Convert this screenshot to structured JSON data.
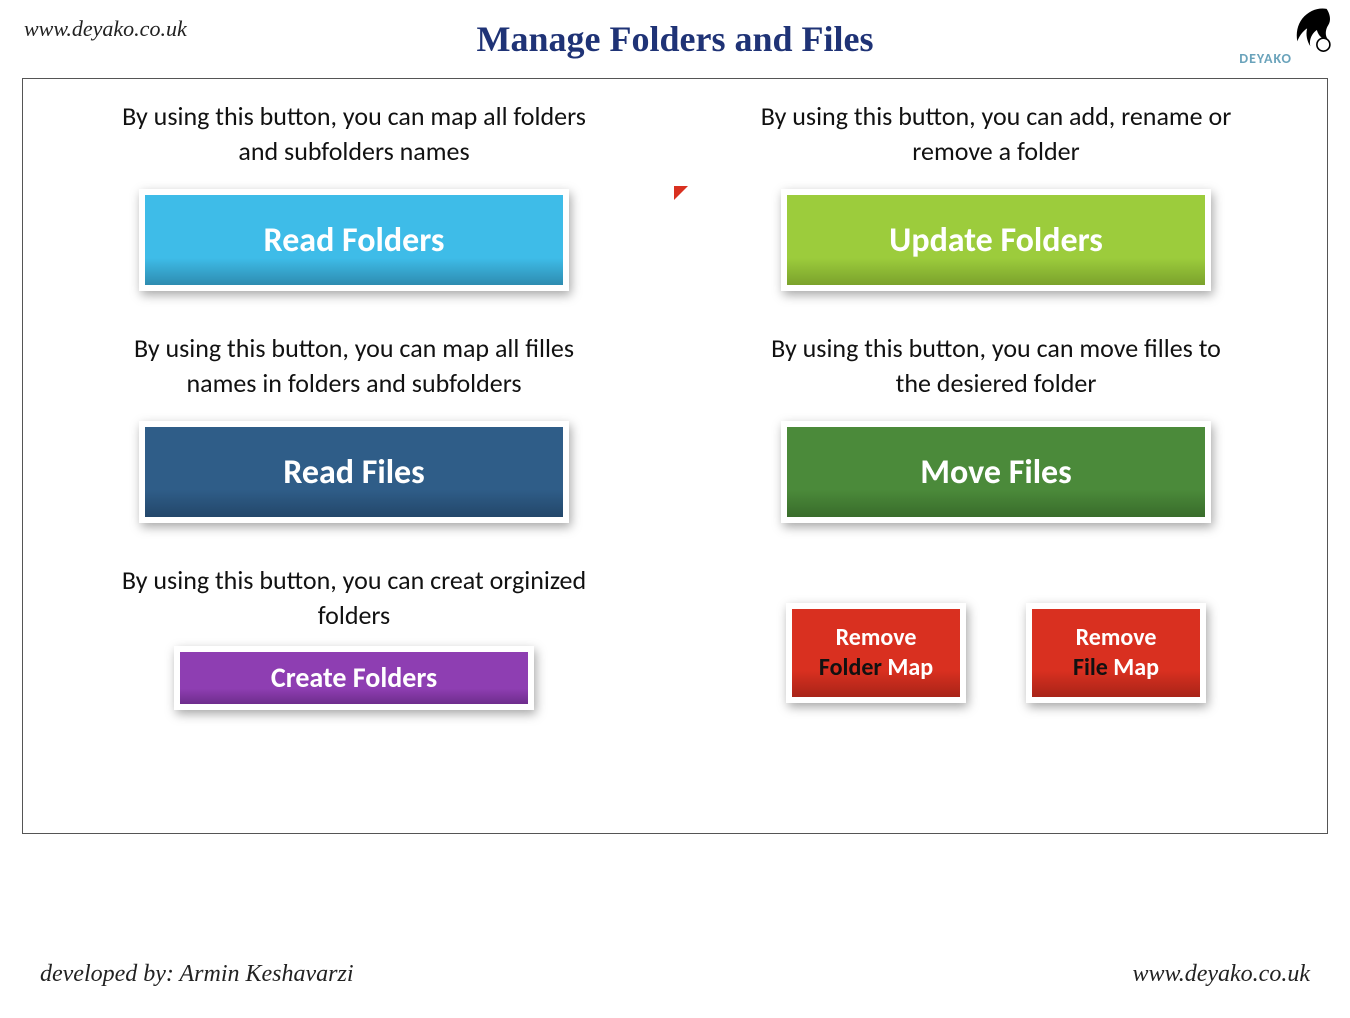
{
  "header": {
    "url": "www.deyako.co.uk",
    "title": "Manage Folders and Files",
    "logo_text": "DEYAKO"
  },
  "left": {
    "block1": {
      "blurb": "By using this button, you can map all folders and subfolders names",
      "button": "Read Folders"
    },
    "block2": {
      "blurb": "By using this button, you can map all filles names in folders and subfolders",
      "button": "Read Files"
    },
    "block3": {
      "blurb": "By using this button, you can creat orginized folders",
      "button": "Create Folders"
    }
  },
  "right": {
    "block1": {
      "blurb": "By using this button, you can add, rename or remove a folder",
      "button": "Update Folders"
    },
    "block2": {
      "blurb": "By using this button, you can move filles to the desiered folder",
      "button": "Move Files"
    },
    "remove_folder_map": {
      "line1": "Remove",
      "line2_dark": "Folder",
      "line2_white": " Map"
    },
    "remove_file_map": {
      "line1": "Remove",
      "line2_dark": "File",
      "line2_white": " Map"
    }
  },
  "footer": {
    "developer": "developed by: Armin Keshavarzi",
    "url": "www.deyako.co.uk"
  }
}
